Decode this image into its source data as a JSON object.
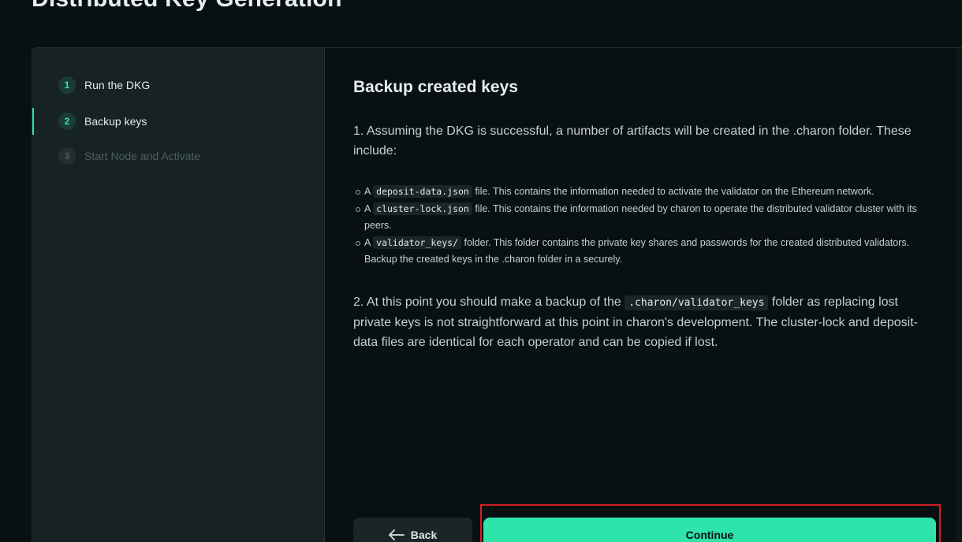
{
  "page": {
    "title": "Distributed Key Generation"
  },
  "steps": [
    {
      "number": "1",
      "label": "Run the DKG",
      "state": "completed"
    },
    {
      "number": "2",
      "label": "Backup keys",
      "state": "active"
    },
    {
      "number": "3",
      "label": "Start Node and Activate",
      "state": "disabled"
    }
  ],
  "content": {
    "title": "Backup created keys",
    "intro": "1. Assuming the DKG is successful, a number of artifacts will be created in the .charon folder. These include:",
    "bullets": [
      {
        "prefix": "A",
        "code": "deposit-data.json",
        "text": "file. This contains the information needed to activate the validator on the Ethereum network."
      },
      {
        "prefix": "A",
        "code": "cluster-lock.json",
        "text": "file. This contains the information needed by charon to operate the distributed validator cluster with its peers."
      },
      {
        "prefix": "A",
        "code": "validator_keys/",
        "text": "folder. This folder contains the private key shares and passwords for the created distributed validators. Backup the created keys in the .charon folder in a securely."
      }
    ],
    "step2": {
      "before": "2. At this point you should make a backup of the",
      "code": ".charon/validator_keys",
      "after": "folder as replacing lost private keys is not straightforward at this point in charon's development. The cluster-lock and deposit-data files are identical for each operator and can be copied if lost."
    }
  },
  "buttons": {
    "back_label": "Back",
    "back_icon": "arrow-left-icon",
    "continue_label": "Continue"
  },
  "colors": {
    "accent": "#2fe4ab",
    "background": "#091011",
    "sidebar": "#162224",
    "highlight": "#d11f25"
  }
}
